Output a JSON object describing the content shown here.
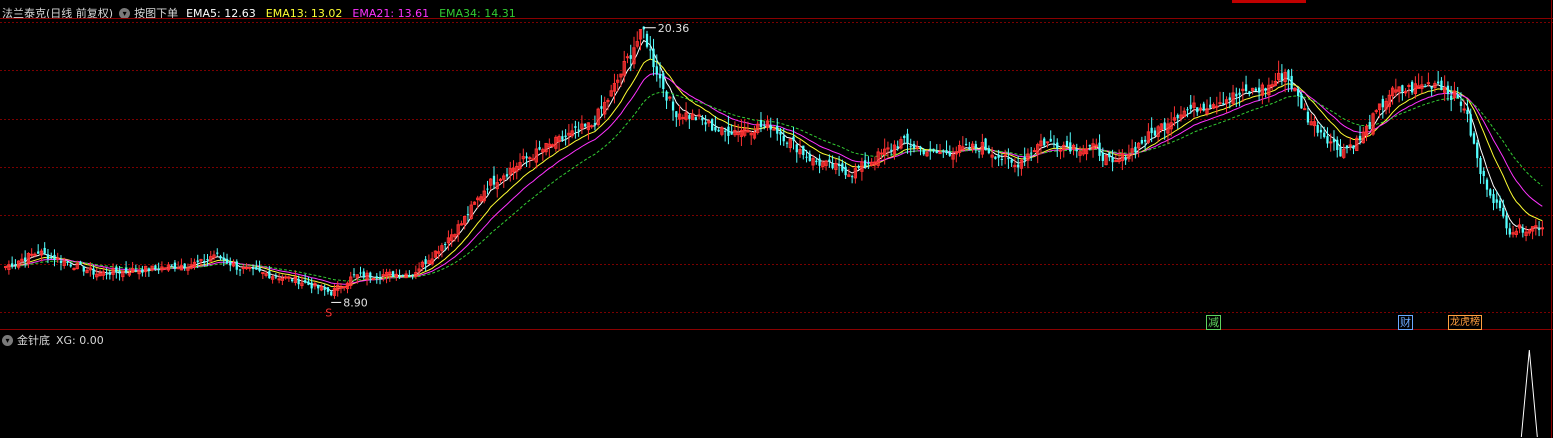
{
  "main_header": {
    "title": "法兰泰克(日线 前复权)",
    "order_label": "按图下单",
    "ema5": "EMA5: 12.63",
    "ema13": "EMA13: 13.02",
    "ema21": "EMA21: 13.61",
    "ema34": "EMA34: 14.31"
  },
  "indicator_header": {
    "title": "金针底",
    "xg": "XG: 0.00"
  },
  "markers": {
    "high_label": "20.36",
    "low_label": "8.90",
    "s_label": "S"
  },
  "signals": [
    {
      "text": "减",
      "color": "#5fd35f"
    },
    {
      "text": "财",
      "color": "#6aa9ff"
    },
    {
      "text": "龙虎榜",
      "color": "#ffa040"
    }
  ],
  "colors": {
    "up": "#ff3232",
    "down": "#54ffff",
    "ema5": "#ffffff",
    "ema13": "#ffff33",
    "ema21": "#ff33ff",
    "ema34": "#33cc33",
    "grid": "#7a0000",
    "indicator": "#ffffff"
  },
  "chart_data": {
    "type": "candlestick",
    "price_range": [
      8.9,
      20.36
    ],
    "close_anchors": [
      [
        0,
        10.4
      ],
      [
        10,
        11.0
      ],
      [
        18,
        10.6
      ],
      [
        28,
        10.1
      ],
      [
        45,
        10.3
      ],
      [
        60,
        10.55
      ],
      [
        64,
        10.9
      ],
      [
        72,
        10.3
      ],
      [
        90,
        9.8
      ],
      [
        100,
        9.3
      ],
      [
        107,
        10.0
      ],
      [
        125,
        10.1
      ],
      [
        132,
        11.0
      ],
      [
        140,
        12.2
      ],
      [
        148,
        13.8
      ],
      [
        160,
        14.9
      ],
      [
        172,
        15.8
      ],
      [
        180,
        16.3
      ],
      [
        186,
        17.6
      ],
      [
        193,
        19.6
      ],
      [
        196,
        20.2
      ],
      [
        199,
        18.9
      ],
      [
        205,
        16.9
      ],
      [
        212,
        16.6
      ],
      [
        220,
        16.0
      ],
      [
        235,
        16.3
      ],
      [
        248,
        14.8
      ],
      [
        260,
        14.3
      ],
      [
        275,
        15.6
      ],
      [
        285,
        15.1
      ],
      [
        300,
        15.4
      ],
      [
        310,
        14.6
      ],
      [
        318,
        15.6
      ],
      [
        328,
        15.4
      ],
      [
        335,
        15.3
      ],
      [
        340,
        14.6
      ],
      [
        350,
        15.7
      ],
      [
        360,
        16.8
      ],
      [
        375,
        17.4
      ],
      [
        388,
        17.9
      ],
      [
        393,
        18.5
      ],
      [
        400,
        16.6
      ],
      [
        410,
        15.2
      ],
      [
        416,
        15.7
      ],
      [
        425,
        17.6
      ],
      [
        440,
        18.1
      ],
      [
        448,
        17.1
      ],
      [
        453,
        14.3
      ],
      [
        462,
        11.9
      ],
      [
        472,
        12.1
      ]
    ],
    "ema_periods": [
      5,
      13,
      21,
      34
    ],
    "ema_last": {
      "EMA5": 12.63,
      "EMA13": 13.02,
      "EMA21": 13.61,
      "EMA34": 14.31
    },
    "indicator": {
      "name": "金针底",
      "XG": 0.0,
      "spike_at_bar": 468
    }
  }
}
